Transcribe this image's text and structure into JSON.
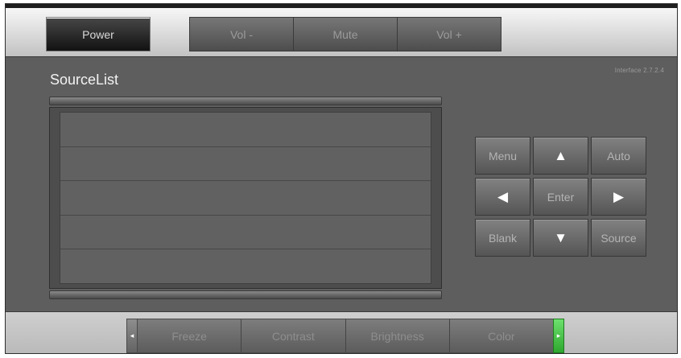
{
  "top_bar": {
    "power_label": "Power",
    "volume_buttons": [
      "Vol -",
      "Mute",
      "Vol +"
    ]
  },
  "version": "Interface 2.7.2.4",
  "source_list": {
    "title": "SourceList",
    "rows": [
      "",
      "",
      "",
      "",
      ""
    ]
  },
  "nav": {
    "menu_label": "Menu",
    "up_arrow": "▲",
    "auto_label": "Auto",
    "left_arrow": "◀",
    "enter_label": "Enter",
    "right_arrow": "▶",
    "blank_label": "Blank",
    "down_arrow": "▼",
    "source_label": "Source"
  },
  "bottom_bar": {
    "left_arrow": "◂",
    "right_arrow": "▸",
    "buttons": [
      "Freeze",
      "Contrast",
      "Brightness",
      "Color"
    ]
  },
  "colors": {
    "panel_background": "#5e5e5e",
    "scroll_right_accent": "#3fbf3f"
  },
  "icons": [
    "up-arrow-icon",
    "down-arrow-icon",
    "left-arrow-icon",
    "right-arrow-icon"
  ]
}
